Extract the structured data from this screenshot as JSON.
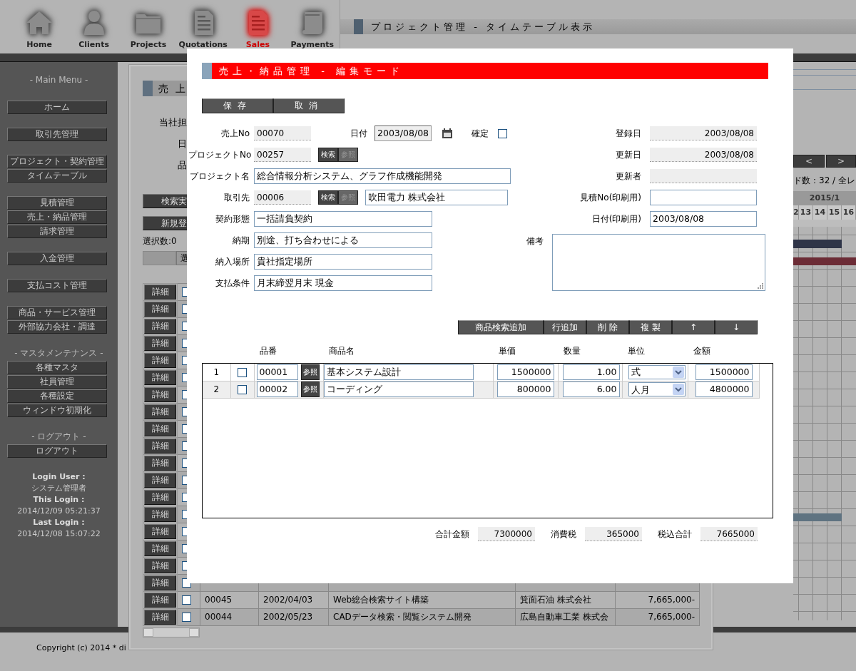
{
  "nav": [
    {
      "label": "Home",
      "kind": "home",
      "selected": false
    },
    {
      "label": "Clients",
      "kind": "person",
      "selected": false
    },
    {
      "label": "Projects",
      "kind": "folder",
      "selected": false
    },
    {
      "label": "Quotations",
      "kind": "document",
      "selected": false
    },
    {
      "label": "Sales",
      "kind": "document",
      "selected": true
    },
    {
      "label": "Payments",
      "kind": "scroll",
      "selected": false
    }
  ],
  "page_title": "プロジェクト管理 - タイムテーブル表示",
  "sidebar": {
    "groups": [
      {
        "heading": "- Main Menu -",
        "items": [
          "ホーム"
        ]
      },
      {
        "items": [
          "取引先管理"
        ]
      },
      {
        "items": [
          "プロジェクト・契約管理",
          "タイムテーブル"
        ]
      },
      {
        "items": [
          "見積管理",
          "売上・納品管理",
          "請求管理"
        ]
      },
      {
        "items": [
          "入金管理"
        ]
      },
      {
        "items": [
          "支払コスト管理"
        ]
      },
      {
        "items": [
          "商品・サービス管理",
          "外部協力会社・調達"
        ]
      },
      {
        "heading": "- マスタメンテナンス -",
        "items": [
          "各種マスタ",
          "社員管理",
          "各種設定",
          "ウィンドウ初期化"
        ]
      },
      {
        "heading": "- ログアウト -",
        "items": [
          "ログアウト"
        ]
      }
    ],
    "login_info": [
      {
        "label": "Login User :",
        "value": "システム管理者"
      },
      {
        "label": "This Login :",
        "value": "2014/12/09 05:21:37"
      },
      {
        "label": "Last Login :",
        "value": "2014/12/08 15:07:22"
      }
    ]
  },
  "timeline": {
    "nav_buttons": [
      "<",
      ">"
    ],
    "record_count": "ド数：32 / 全レ",
    "month": "2015/1",
    "days": [
      "2",
      "13",
      "14",
      "15",
      "16"
    ],
    "bars": [
      {
        "color": "#2f3548"
      },
      {
        "color": "#6c2c36"
      },
      {
        "color": "#5f7381"
      }
    ]
  },
  "list_panel": {
    "title": "売上",
    "filter_labels": [
      "当社担",
      "日",
      "品"
    ],
    "buttons": [
      "検索実",
      "新規登"
    ],
    "selection_count": "選択数:0",
    "select_button": "選",
    "rows": [
      {
        "detail": "詳細",
        "checked": false
      },
      {
        "detail": "詳細",
        "checked": false
      },
      {
        "detail": "詳細",
        "checked": false
      },
      {
        "detail": "詳細",
        "checked": false
      },
      {
        "detail": "詳細",
        "checked": false
      },
      {
        "detail": "詳細",
        "checked": false
      },
      {
        "detail": "詳細",
        "checked": false
      },
      {
        "detail": "詳細",
        "checked": false
      },
      {
        "detail": "詳細",
        "checked": false
      },
      {
        "detail": "詳細",
        "checked": false
      },
      {
        "detail": "詳細",
        "checked": false
      },
      {
        "detail": "詳細",
        "checked": false
      },
      {
        "detail": "詳細",
        "checked": false
      },
      {
        "detail": "詳細",
        "checked": false
      },
      {
        "detail": "詳細",
        "checked": false
      },
      {
        "detail": "詳細",
        "checked": false
      },
      {
        "detail": "詳細",
        "checked": false
      },
      {
        "detail": "詳細",
        "checked": false
      },
      {
        "detail": "詳細",
        "checked": false,
        "cells": [
          "00045",
          "2002/04/03",
          "Web総合検索サイト構築",
          "箕面石油 株式会社",
          "7,665,000-"
        ]
      },
      {
        "detail": "詳細",
        "checked": false,
        "cells": [
          "00044",
          "2002/05/23",
          "CADデータ検索・閲覧システム開発",
          "広島自動車工業 株式会",
          "7,665,000-"
        ]
      }
    ]
  },
  "dialog": {
    "title": "売上・納品管理 - 編集モード",
    "actions": [
      "保存",
      "取消"
    ],
    "sales_no": {
      "label": "売上No",
      "value": "00070"
    },
    "date": {
      "label": "日付",
      "value": "2003/08/08"
    },
    "confirmed": {
      "label": "確定",
      "checked": false
    },
    "project_no": {
      "label": "プロジェクトNo",
      "value": "00257"
    },
    "project_buttons": [
      {
        "label": "検索",
        "disabled": false
      },
      {
        "label": "参照",
        "disabled": true
      }
    ],
    "project_name": {
      "label": "プロジェクト名",
      "value": "総合情報分析システム、グラフ作成機能開発"
    },
    "client": {
      "label": "取引先",
      "code": "00006",
      "name": "吹田電力 株式会社"
    },
    "client_buttons": [
      {
        "label": "検索",
        "disabled": false
      },
      {
        "label": "参照",
        "disabled": true
      }
    ],
    "contract_type": {
      "label": "契約形態",
      "value": "一括請負契約"
    },
    "delivery": {
      "label": "納期",
      "value": "別途、打ち合わせによる"
    },
    "delivery_place": {
      "label": "納入場所",
      "value": "貴社指定場所"
    },
    "payment_terms": {
      "label": "支払条件",
      "value": "月末締翌月末 現金"
    },
    "registered": {
      "label": "登録日",
      "value": "2003/08/08"
    },
    "updated": {
      "label": "更新日",
      "value": "2003/08/08"
    },
    "updated_by": {
      "label": "更新者"
    },
    "quote_no": {
      "label": "見積No(印刷用)"
    },
    "print_date": {
      "label": "日付(印刷用)",
      "value": "2003/08/08"
    },
    "remarks": {
      "label": "備考"
    },
    "line_toolbar": [
      "商品検索追加",
      "行追加",
      "削 除",
      "複 製",
      "↑",
      "↓"
    ],
    "columns": [
      "品番",
      "商品名",
      "単価",
      "数量",
      "単位",
      "金額"
    ],
    "lines": [
      {
        "no": "1",
        "checked": false,
        "code": "00001",
        "ref": "参照",
        "name": "基本システム設計",
        "price": "1500000",
        "qty": "1.00",
        "unit": "式",
        "amount": "1500000"
      },
      {
        "no": "2",
        "checked": false,
        "code": "00002",
        "ref": "参照",
        "name": "コーディング",
        "price": "800000",
        "qty": "6.00",
        "unit": "人月",
        "amount": "4800000"
      }
    ],
    "totals": [
      {
        "label": "合計金額",
        "value": "7300000"
      },
      {
        "label": "消費税",
        "value": "365000"
      },
      {
        "label": "税込合計",
        "value": "7665000"
      }
    ]
  },
  "footer": {
    "copyright": "Copyright (c) 2014 * di"
  }
}
